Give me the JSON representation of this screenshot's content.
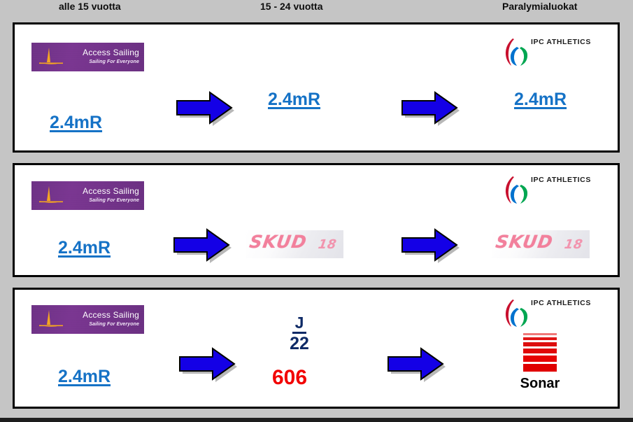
{
  "headers": [
    {
      "label": "alle 15 vuotta"
    },
    {
      "label": "15 - 24 vuotta"
    },
    {
      "label": "Paralymialuokat"
    }
  ],
  "logos": {
    "access_sailing": {
      "brand": "Access Sailing",
      "tagline": "Sailing For Everyone",
      "bg_color": "#73308b",
      "sail_color": "#f5a623"
    },
    "ipc_athletics": {
      "text": "IPC ATHLETICS",
      "agito_red": "#c8102e",
      "agito_blue": "#0072ce",
      "agito_green": "#00a651"
    },
    "sonar": {
      "label": "Sonar",
      "bar_color": "#e00000",
      "bar_count": 6
    }
  },
  "rows": [
    {
      "name": "row-1",
      "col1_class": "2.4mR",
      "col2_class": "2.4mR",
      "col3_class": "2.4mR"
    },
    {
      "name": "row-2",
      "col1_class": "2.4mR",
      "col2_skud_word": "SKUD",
      "col2_skud_number": "18",
      "col3_skud_word": "SKUD",
      "col3_skud_number": "18"
    },
    {
      "name": "row-3",
      "col1_class": "2.4mR",
      "col2_j_letter": "J",
      "col2_j_number": "22",
      "col2_six06": "606",
      "col3_label": "Sonar"
    }
  ],
  "colors": {
    "class_label_blue": "#1572c6",
    "arrow_blue": "#1400e6",
    "j22_navy": "#0e2a66",
    "red_606": "#f20000",
    "page_background": "#c5c5c5",
    "skud_pink": "#f2809c"
  }
}
